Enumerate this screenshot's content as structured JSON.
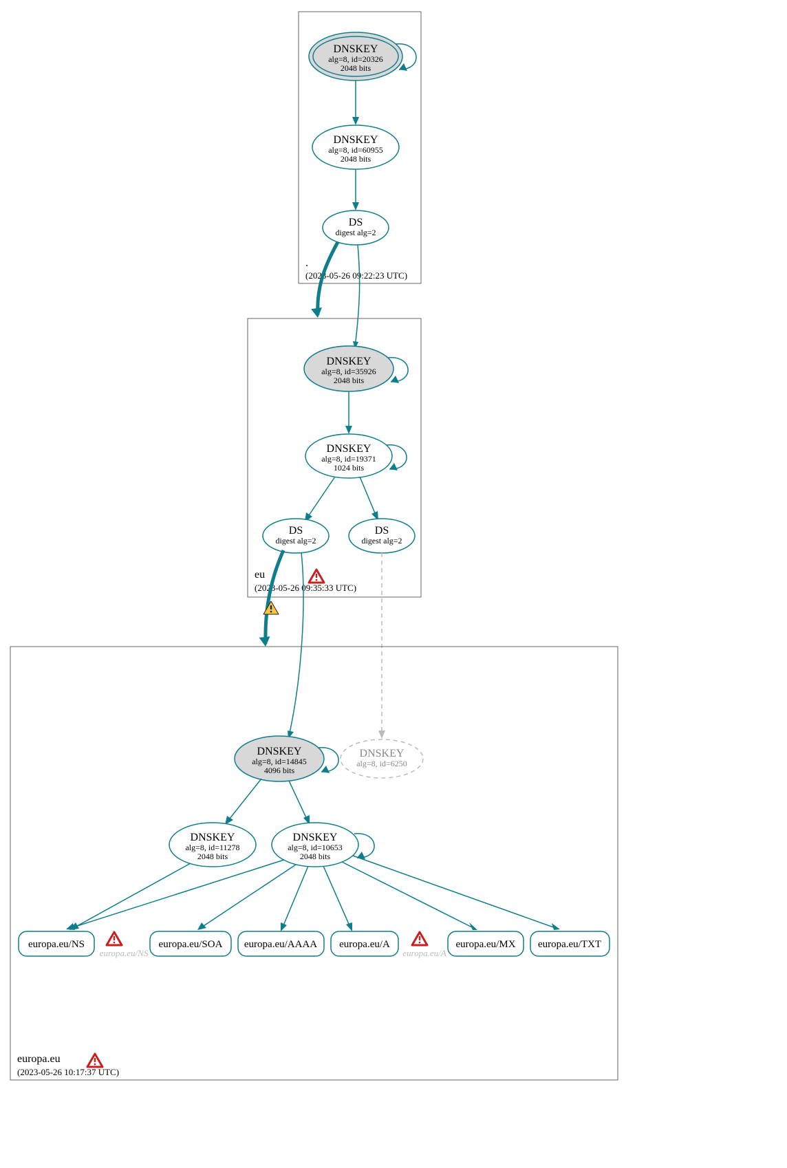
{
  "colors": {
    "accent": "#0e7e8c",
    "warning": "#c81f1f",
    "caution": "#f6c643"
  },
  "zones": [
    {
      "name": ".",
      "time": "(2023-05-26 09:22:23 UTC)"
    },
    {
      "name": "eu",
      "time": "(2023-05-26 09:35:33 UTC)"
    },
    {
      "name": "europa.eu",
      "time": "(2023-05-26 10:17:37 UTC)"
    }
  ],
  "nodes": {
    "root_ksk": {
      "title": "DNSKEY",
      "sub1": "alg=8, id=20326",
      "sub2": "2048 bits"
    },
    "root_zsk": {
      "title": "DNSKEY",
      "sub1": "alg=8, id=60955",
      "sub2": "2048 bits"
    },
    "root_ds": {
      "title": "DS",
      "sub1": "digest alg=2"
    },
    "eu_ksk": {
      "title": "DNSKEY",
      "sub1": "alg=8, id=35926",
      "sub2": "2048 bits"
    },
    "eu_zsk": {
      "title": "DNSKEY",
      "sub1": "alg=8, id=19371",
      "sub2": "1024 bits"
    },
    "eu_ds1": {
      "title": "DS",
      "sub1": "digest alg=2"
    },
    "eu_ds2": {
      "title": "DS",
      "sub1": "digest alg=2"
    },
    "eur_ksk": {
      "title": "DNSKEY",
      "sub1": "alg=8, id=14845",
      "sub2": "4096 bits"
    },
    "eur_ghost": {
      "title": "DNSKEY",
      "sub1": "alg=8, id=6250"
    },
    "eur_zsk1": {
      "title": "DNSKEY",
      "sub1": "alg=8, id=11278",
      "sub2": "2048 bits"
    },
    "eur_zsk2": {
      "title": "DNSKEY",
      "sub1": "alg=8, id=10653",
      "sub2": "2048 bits"
    }
  },
  "rrsets": {
    "ns": "europa.eu/NS",
    "soa": "europa.eu/SOA",
    "aaaa": "europa.eu/AAAA",
    "a": "europa.eu/A",
    "mx": "europa.eu/MX",
    "txt": "europa.eu/TXT",
    "ghost_ns": "europa.eu/NS",
    "ghost_a": "europa.eu/A"
  }
}
